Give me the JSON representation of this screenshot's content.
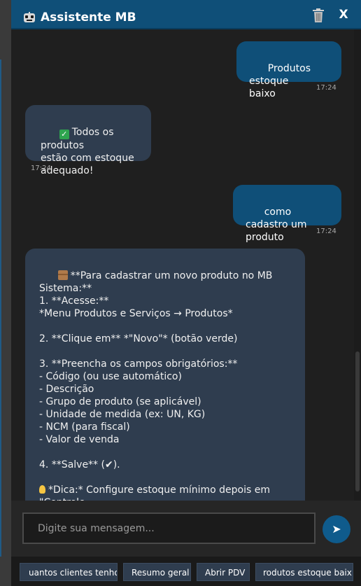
{
  "window": {
    "title": "Assistente MB",
    "icons": {
      "bot": "robot-icon",
      "trash": "trash-icon"
    },
    "close_label": "X"
  },
  "messages": [
    {
      "role": "user",
      "text": "Produtos estoque\nbaixo",
      "time": "17:24"
    },
    {
      "role": "bot",
      "icon": "check-mark-emoji",
      "text": "Todos os produtos\nestão com estoque\nadequado!",
      "time": "17:24"
    },
    {
      "role": "user",
      "text": "como cadastro um\nproduto",
      "time": "17:24"
    },
    {
      "role": "bot",
      "icon": "package-emoji",
      "heading": "**Para cadastrar um novo produto no MB Sistema:**",
      "body": "1. **Acesse:**\n*Menu Produtos e Serviços → Produtos*\n\n2. **Clique em** *\"Novo\"* (botão verde)\n\n3. **Preencha os campos obrigatórios:**\n- Código (ou use automático)\n- Descrição\n- Grupo de produto (se aplicável)\n- Unidade de medida (ex: UN, KG)\n- NCM (para fiscal)\n- Valor de venda\n\n4. **Salve** (✔).\n\n",
      "tip_icon": "light-bulb-emoji",
      "tip": "*Dica:* Configure estoque mínimo depois em \"Controle\nde Estoque\" no mesmo cadastro."
    }
  ],
  "composer": {
    "placeholder": "Digite sua mensagem...",
    "send_icon": "send-arrow-icon",
    "send_glyph": "➤"
  },
  "quick_actions": [
    "uantos clientes tenho",
    "Resumo geral",
    "Abrir PDV",
    "rodutos estoque baix"
  ],
  "colors": {
    "accent": "#0f4f78",
    "bot_bubble": "#2f3d4f",
    "background": "#1f1f1f"
  }
}
